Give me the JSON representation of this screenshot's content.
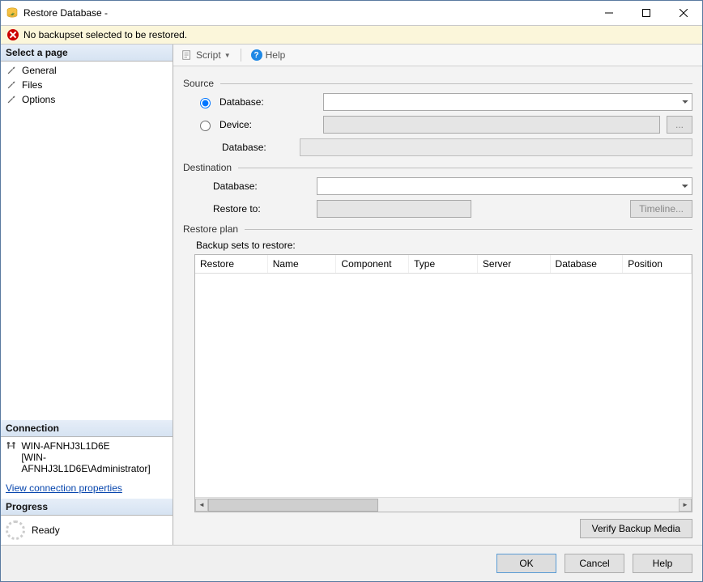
{
  "window": {
    "title": "Restore Database -"
  },
  "error": {
    "message": "No backupset selected to be restored."
  },
  "leftPanel": {
    "selectPageHeader": "Select a page",
    "pages": [
      "General",
      "Files",
      "Options"
    ],
    "connectionHeader": "Connection",
    "server": "WIN-AFNHJ3L1D6E",
    "login": "[WIN-AFNHJ3L1D6E\\Administrator]",
    "viewConnectionLink": "View connection properties",
    "progressHeader": "Progress",
    "progressStatus": "Ready"
  },
  "toolbar": {
    "script": "Script",
    "help": "Help"
  },
  "form": {
    "sourceHeader": "Source",
    "radioDatabase": "Database:",
    "radioDevice": "Device:",
    "sourceDbLabel": "Database:",
    "destHeader": "Destination",
    "destDbLabel": "Database:",
    "restoreToLabel": "Restore to:",
    "timelineBtn": "Timeline...",
    "browseBtn": "...",
    "restorePlanHeader": "Restore plan",
    "backupSetsLabel": "Backup sets to restore:",
    "columns": [
      "Restore",
      "Name",
      "Component",
      "Type",
      "Server",
      "Database",
      "Position"
    ],
    "verifyBtn": "Verify Backup Media",
    "values": {
      "sourceDatabase": "",
      "device": "",
      "deviceDatabase": "",
      "destDatabase": "",
      "restoreTo": ""
    }
  },
  "footer": {
    "ok": "OK",
    "cancel": "Cancel",
    "help": "Help"
  }
}
